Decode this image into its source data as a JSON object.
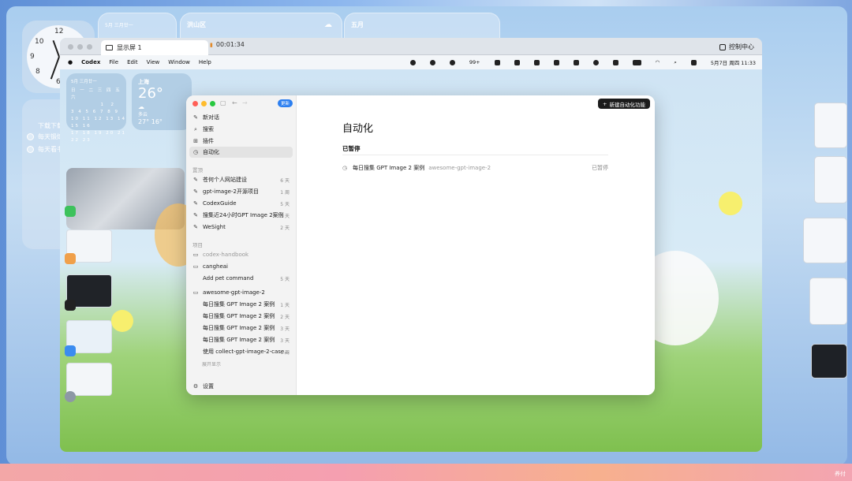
{
  "desktop": {
    "widget_month_label": "五月",
    "widget_city": "洪山区",
    "widget_date_small": "5月  三月廿一",
    "todo_title": "下载下载",
    "todo_items": [
      "每天锻炼",
      "每天看书"
    ],
    "credit": "养付"
  },
  "window": {
    "tab_label": "显示屏 1",
    "timer": "00:01:34",
    "control_center": "控制中心"
  },
  "menubar": {
    "app_name": "Codex",
    "items": [
      "File",
      "Edit",
      "View",
      "Window",
      "Help"
    ],
    "badge": "99+",
    "datetime": "5月7日 周四  11:33"
  },
  "mini_widgets": {
    "weather_city": "上海",
    "weather_temp": "26°",
    "weather_desc": "多云",
    "weather_range": "27° 16°",
    "cal_header": "5月  三月廿一",
    "cal_weekdays": "日 一 二 三 四 五 六",
    "cal_rows": [
      "          1  2",
      "3  4  5  6  7  8  9",
      "10 11 12 13 14 15 16",
      "17 18 19 20 21 22 23",
      "24 25 26 27 28 29 30",
      "31"
    ]
  },
  "app": {
    "update_badge": "更新",
    "nav": [
      {
        "icon": "✎",
        "label": "新对话"
      },
      {
        "icon": "⌕",
        "label": "搜索"
      },
      {
        "icon": "⊞",
        "label": "插件"
      },
      {
        "icon": "◷",
        "label": "自动化"
      }
    ],
    "pinned_header": "置顶",
    "pinned": [
      {
        "label": "苍何个人网站建设",
        "meta": "6 天"
      },
      {
        "label": "gpt-image-2开源项目",
        "meta": "1 周"
      },
      {
        "label": "CodexGuide",
        "meta": "5 天"
      },
      {
        "label": "搜集近24小时GPT Image 2案例",
        "meta": "3 天"
      },
      {
        "label": "WeSight",
        "meta": "2 天"
      }
    ],
    "projects_header": "项目",
    "projects": [
      {
        "label": "codex-handbook",
        "meta": "",
        "muted": true
      },
      {
        "label": "cangheai",
        "meta": "",
        "muted": false
      },
      {
        "label": "Add pet command",
        "meta": "5 天",
        "muted": false
      },
      {
        "label": "awesome-gpt-image-2",
        "meta": "",
        "muted": false
      }
    ],
    "threads": [
      {
        "label": "每日搜集 GPT Image 2 案例",
        "meta": "1 天"
      },
      {
        "label": "每日搜集 GPT Image 2 案例",
        "meta": "2 天"
      },
      {
        "label": "每日搜集 GPT Image 2 案例",
        "meta": "3 天"
      },
      {
        "label": "每日搜集 GPT Image 2 案例",
        "meta": "3 天"
      },
      {
        "label": "使用 collect-gpt-image-2-case...",
        "meta": "1 周"
      }
    ],
    "show_more": "展开显示",
    "settings": "设置",
    "new_automation": "新建自动化功能",
    "main_title": "自动化",
    "paused_header": "已暂停",
    "task_name": "每日搜集 GPT Image 2 案例",
    "task_repo": "awesome-gpt-image-2",
    "task_status": "已暂停"
  },
  "dock_colors": [
    "#4a9ff5",
    "#e9eef3",
    "#3f87e8",
    "#43c55a",
    "#4d8ee8",
    "#3b7be0",
    "#f2c24a",
    "#39b54a",
    "#3dc25c",
    "#f5f5f5",
    "#9aa3ad",
    "#f3f3f3",
    "#f5d66a",
    "#222222",
    "#f2455b",
    "#3b83f0",
    "#39b54a",
    "#f29b38",
    "#f25a45",
    "#3b8cf0",
    "#3b6de0",
    "#8d98a5",
    "#222222",
    "#eef2f6",
    "#e0e4ea",
    "#7a5af0",
    "#eef2f6",
    "#3b7be0",
    "#222222",
    "#2d2d2d",
    "#9b8cf5",
    "#3b8cf0",
    "#4ec25a",
    "#6b9cf0",
    "#222222",
    "#f0c9a0",
    "#f08a3c",
    "#c8ccd2"
  ]
}
